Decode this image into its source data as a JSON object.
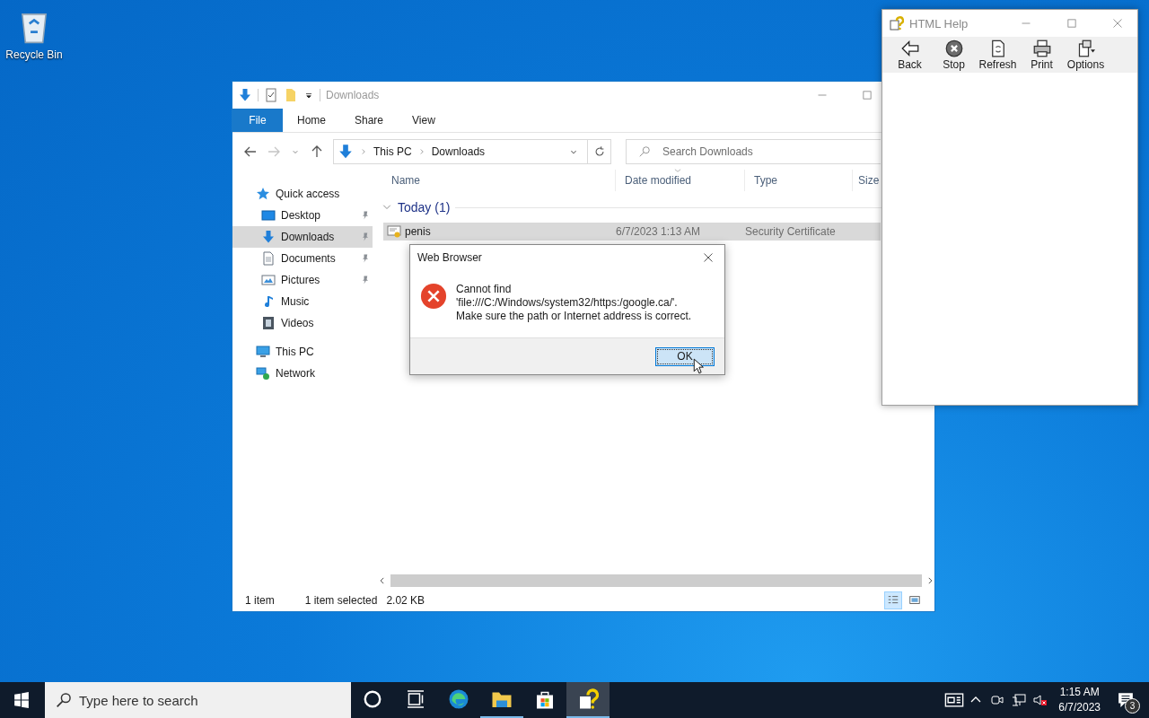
{
  "desktop_icons": [
    {
      "label": "Recycle Bin"
    }
  ],
  "explorer": {
    "title": "Downloads",
    "ribbon_tabs": [
      {
        "label": "File",
        "selected": true
      },
      {
        "label": "Home",
        "selected": false
      },
      {
        "label": "Share",
        "selected": false
      },
      {
        "label": "View",
        "selected": false
      }
    ],
    "breadcrumb": [
      "This PC",
      "Downloads"
    ],
    "search": {
      "placeholder": "Search Downloads"
    },
    "sidebar": [
      {
        "label": "Quick access",
        "selected": false,
        "children": [
          {
            "label": "Desktop",
            "pinned": true,
            "selected": false
          },
          {
            "label": "Downloads",
            "pinned": true,
            "selected": true
          },
          {
            "label": "Documents",
            "pinned": true,
            "selected": false
          },
          {
            "label": "Pictures",
            "pinned": true,
            "selected": false
          },
          {
            "label": "Music",
            "pinned": false,
            "selected": false
          },
          {
            "label": "Videos",
            "pinned": false,
            "selected": false
          }
        ]
      },
      {
        "label": "This PC",
        "selected": false
      },
      {
        "label": "Network",
        "selected": false
      }
    ],
    "columns": [
      "Name",
      "Date modified",
      "Type",
      "Size"
    ],
    "groups": [
      {
        "label": "Today (1)",
        "expanded": true,
        "rows": [
          {
            "name": "penis",
            "date": "6/7/2023 1:13 AM",
            "type": "Security Certificate",
            "selected": true
          }
        ]
      }
    ],
    "status_bar": {
      "count": "1 item",
      "selection": "1 item selected",
      "size": "2.02 KB"
    },
    "views": [
      {
        "kind": "details",
        "selected": true
      },
      {
        "kind": "large-icons",
        "selected": false
      }
    ]
  },
  "help_window": {
    "title": "HTML Help",
    "toolbar": [
      {
        "label": "Back"
      },
      {
        "label": "Stop"
      },
      {
        "label": "Refresh"
      },
      {
        "label": "Print"
      },
      {
        "label": "Options"
      }
    ]
  },
  "dialog": {
    "title": "Web Browser",
    "message": [
      "Cannot find",
      "'file:///C:/Windows/system32/https:/google.ca/'.",
      "Make sure the path or Internet address is correct."
    ],
    "buttons": [
      {
        "label": "OK",
        "focused": true
      }
    ]
  },
  "taskbar": {
    "search": {
      "placeholder": "Type here to search"
    },
    "apps": [
      {
        "running": false,
        "selected": false
      },
      {
        "running": false,
        "selected": false
      },
      {
        "running": false,
        "selected": false
      },
      {
        "running": true,
        "selected": false
      },
      {
        "running": false,
        "selected": false
      },
      {
        "running": true,
        "selected": true
      }
    ],
    "clock": {
      "time": "1:15 AM",
      "date": "6/7/2023"
    },
    "notifications": "3"
  }
}
